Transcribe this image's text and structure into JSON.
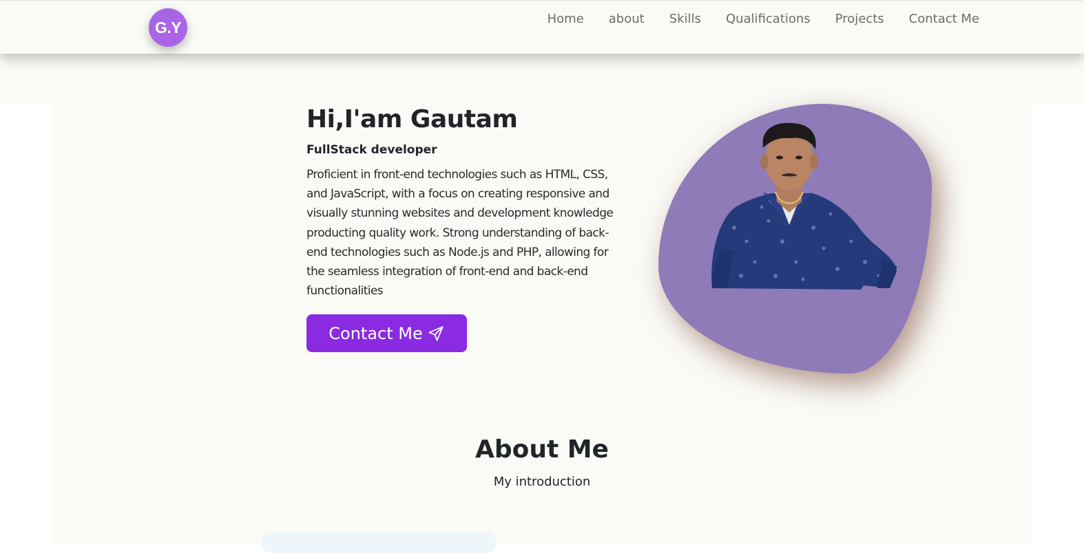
{
  "navbar": {
    "logo_text": "G.Y",
    "links": [
      {
        "label": "Home"
      },
      {
        "label": "about"
      },
      {
        "label": "Skills"
      },
      {
        "label": "Qualifications"
      },
      {
        "label": "Projects"
      },
      {
        "label": "Contact Me"
      }
    ]
  },
  "hero": {
    "title": "Hi,I'am Gautam",
    "subtitle": "FullStack developer",
    "description": "Proficient in front-end technologies such as HTML, CSS, and JavaScript, with a focus on creating responsive and visually stunning websites and development knowledge producting quality work. Strong understanding of back-end technologies such as Node.js and PHP, allowing for the seamless integration of front-end and back-end functionalities",
    "contact_button_label": "Contact Me",
    "contact_button_icon": "send-icon"
  },
  "about": {
    "title": "About Me",
    "subtitle": "My introduction"
  },
  "colors": {
    "accent": "#8a2be2",
    "logo_bg": "#a965e6",
    "blob": "#8e7bb8",
    "page_bg": "#fafaf7"
  }
}
